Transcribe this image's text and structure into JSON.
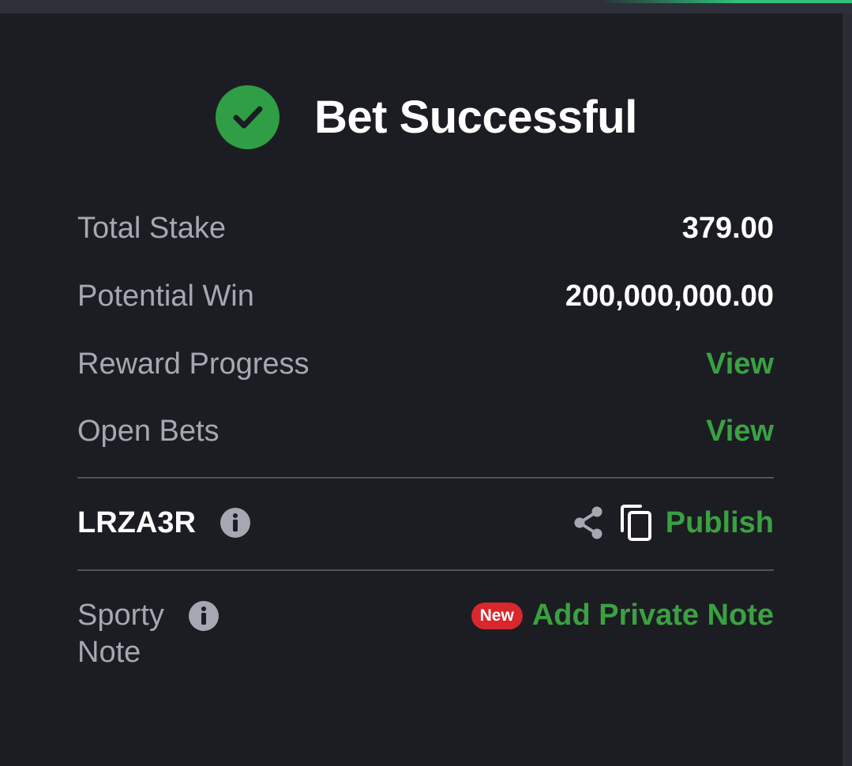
{
  "header": {
    "title": "Bet Successful",
    "icon": "check-circle-icon",
    "icon_color": "#2f9e44"
  },
  "summary": {
    "total_stake_label": "Total Stake",
    "total_stake_value": "379.00",
    "potential_win_label": "Potential Win",
    "potential_win_value": "200,000,000.00",
    "reward_progress_label": "Reward Progress",
    "reward_progress_action": "View",
    "open_bets_label": "Open Bets",
    "open_bets_action": "View"
  },
  "booking": {
    "code": "LRZA3R",
    "info_icon": "info-icon",
    "share_icon": "share-icon",
    "copy_icon": "copy-icon",
    "publish_label": "Publish"
  },
  "note": {
    "label": "Sporty Note",
    "info_icon": "info-icon",
    "badge": "New",
    "action_label": "Add Private Note"
  },
  "colors": {
    "background": "#1c1d22",
    "accent_green": "#3aa142",
    "badge_red": "#d9272e",
    "label_gray": "#a5a8b3"
  }
}
